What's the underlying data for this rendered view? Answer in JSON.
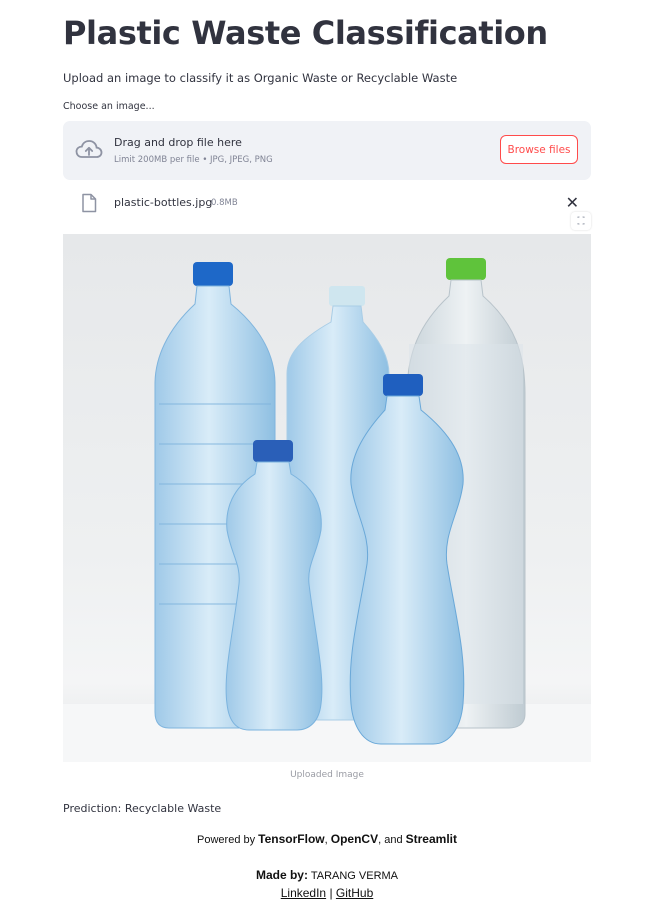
{
  "page": {
    "title": "Plastic Waste Classification",
    "subtitle": "Upload an image to classify it as Organic Waste or Recyclable Waste"
  },
  "uploader": {
    "label": "Choose an image...",
    "drag_text": "Drag and drop file here",
    "limit_text": "Limit 200MB per file • JPG, JPEG, PNG",
    "browse_label": "Browse files",
    "accent_color": "#ff4b4b"
  },
  "file": {
    "name": "plastic-bottles.jpg",
    "size": "0.8MB",
    "close_glyph": "✕"
  },
  "image": {
    "caption": "Uploaded Image"
  },
  "result": {
    "prediction_text": "Prediction: Recyclable Waste"
  },
  "footer": {
    "powered_prefix": "Powered by ",
    "tech1": "TensorFlow",
    "sep1": ", ",
    "tech2": "OpenCV",
    "sep2": ", and ",
    "tech3": "Streamlit",
    "made_by_label": "Made by:",
    "author": " TARANG VERMA",
    "link1": "LinkedIn",
    "link_sep": " | ",
    "link2": "GitHub"
  },
  "icons": [
    "cloud-upload-icon",
    "file-icon",
    "close-icon",
    "fullscreen-icon"
  ]
}
